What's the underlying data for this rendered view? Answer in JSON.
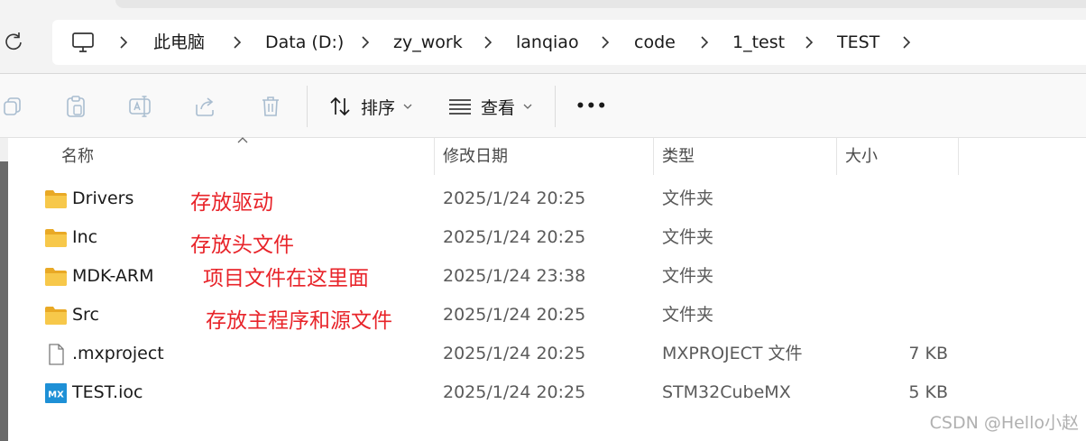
{
  "breadcrumb": {
    "items": [
      "此电脑",
      "Data (D:)",
      "zy_work",
      "lanqiao",
      "code",
      "1_test",
      "TEST"
    ]
  },
  "toolbar": {
    "sort_label": "排序",
    "view_label": "查看",
    "more_label": "•••"
  },
  "columns": {
    "name": "名称",
    "modified": "修改日期",
    "type": "类型",
    "size": "大小"
  },
  "files": [
    {
      "name": "Drivers",
      "modified": "2025/1/24 20:25",
      "type": "文件夹",
      "size": "",
      "icon": "folder-icon"
    },
    {
      "name": "Inc",
      "modified": "2025/1/24 20:25",
      "type": "文件夹",
      "size": "",
      "icon": "folder-icon"
    },
    {
      "name": "MDK-ARM",
      "modified": "2025/1/24 23:38",
      "type": "文件夹",
      "size": "",
      "icon": "folder-icon"
    },
    {
      "name": "Src",
      "modified": "2025/1/24 20:25",
      "type": "文件夹",
      "size": "",
      "icon": "folder-icon"
    },
    {
      "name": ".mxproject",
      "modified": "2025/1/24 20:25",
      "type": "MXPROJECT 文件",
      "size": "7 KB",
      "icon": "file-icon"
    },
    {
      "name": "TEST.ioc",
      "modified": "2025/1/24 20:25",
      "type": "STM32CubeMX",
      "size": "5 KB",
      "icon": "stm32cubemx-icon"
    }
  ],
  "annotations": {
    "drivers": "存放驱动",
    "inc": "存放头文件",
    "mdk": "项目文件在这里面",
    "src": "存放主程序和源文件"
  },
  "watermark": "CSDN @Hello小赵",
  "colors": {
    "annotation": "#e8242a",
    "folder": "#f3c13a",
    "accent": "#1e90d6"
  }
}
